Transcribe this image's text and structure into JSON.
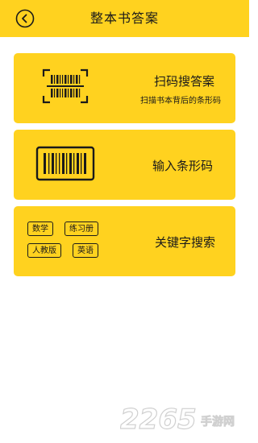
{
  "header": {
    "title": "整本书答案"
  },
  "cards": {
    "scan": {
      "title": "扫码搜答案",
      "subtitle": "扫描书本背后的条形码"
    },
    "barcode": {
      "title": "输入条形码"
    },
    "keyword": {
      "title": "关键字搜索",
      "tags": [
        "数学",
        "练习册",
        "人教版",
        "英语"
      ]
    }
  },
  "watermark": {
    "number": "2265",
    "site": "手游网"
  },
  "colors": {
    "accent": "#FFD21F",
    "text": "#1a1a1a"
  }
}
